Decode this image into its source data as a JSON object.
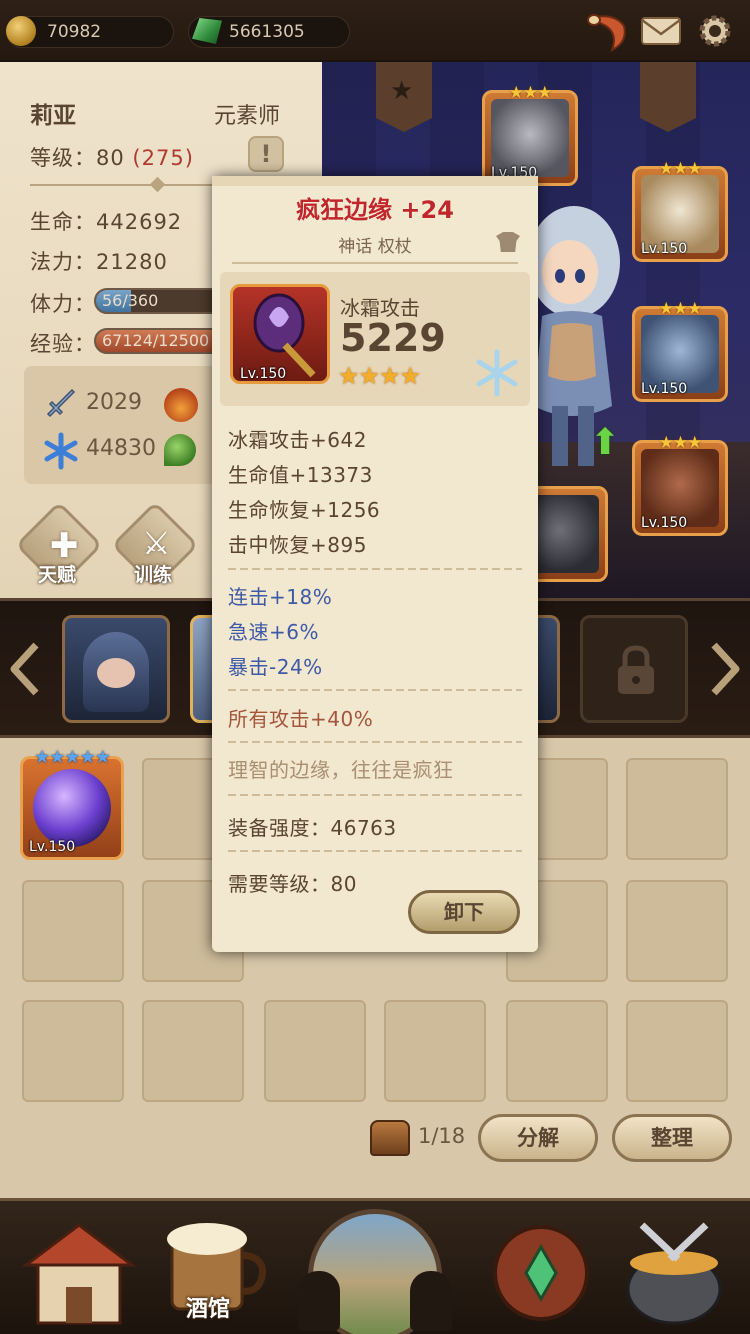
{
  "resources": {
    "gold": "70982",
    "gems": "5661305"
  },
  "hero": {
    "name": "莉亚",
    "class": "元素师",
    "level_label": "等级：",
    "level": "80",
    "level_extra": "(275)",
    "hp_label": "生命：",
    "hp": "442692",
    "mp_label": "法力：",
    "mp": "21280",
    "stamina_label": "体力：",
    "stamina_text": "56/360",
    "stamina_fraction": 0.156,
    "exp_label": "经验：",
    "exp_text": "67124/12500",
    "exp_fraction": 0.54,
    "stats": {
      "attack": "2029",
      "ice": "44830"
    },
    "talent_label": "天赋",
    "training_label": "训练"
  },
  "equipment_slots": [
    {
      "level": "Lv.150",
      "stars": "★★★"
    },
    {
      "level": "Lv.150",
      "stars": "★★★"
    },
    {
      "level": "Lv.150",
      "stars": "★★★"
    },
    {
      "level": "Lv.150",
      "stars": "★★★"
    }
  ],
  "inventory": {
    "first_item_level": "Lv.150",
    "first_item_stars": "★★★★★",
    "count": "1/18",
    "decompose_label": "分解",
    "sort_label": "整理"
  },
  "bottom_nav": {
    "active_label": "酒馆"
  },
  "popup": {
    "title": "疯狂边缘 +24",
    "subtitle": "神话 权杖",
    "item_level": "Lv.150",
    "main_stat_label": "冰霜攻击",
    "main_stat_value": "5229",
    "item_stars": "★★★★",
    "base_stats": [
      "冰霜攻击+642",
      "生命值+13373",
      "生命恢复+1256",
      "击中恢复+895"
    ],
    "bonus_stats": [
      "连击+18%",
      "急速+6%",
      "暴击-24%"
    ],
    "special_stat": "所有攻击+40%",
    "flavor": "理智的边缘，往往是疯狂",
    "power_label": "装备强度：",
    "power_value": "46763",
    "req_label": "需要等级：",
    "req_value": "80",
    "unequip_label": "卸下"
  }
}
